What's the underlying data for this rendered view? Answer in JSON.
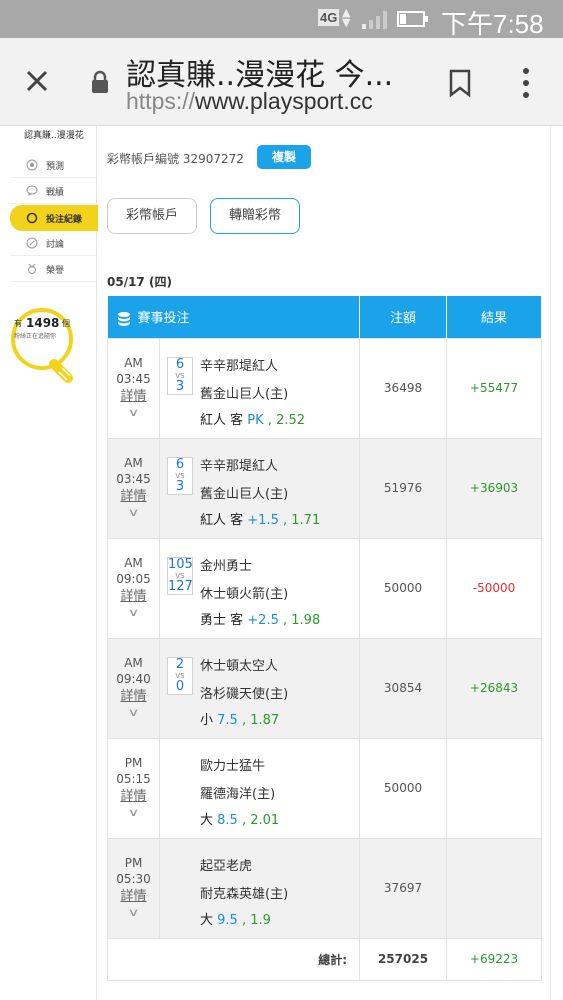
{
  "status_bar": {
    "network": "4G",
    "time": "下午7:58"
  },
  "browser": {
    "page_title": "認真賺..漫漫花 今...",
    "url_protocol": "https://",
    "url_host": "www.playsport.cc"
  },
  "sidebar": {
    "username": "認真賺..漫漫花",
    "items": [
      {
        "label": "預測",
        "icon": "target-icon"
      },
      {
        "label": "戰績",
        "icon": "chat-icon"
      },
      {
        "label": "投注紀錄",
        "icon": "circle-icon",
        "active": true
      },
      {
        "label": "討論",
        "icon": "edit-icon"
      },
      {
        "label": "榮譽",
        "icon": "medal-icon"
      }
    ],
    "fans": {
      "prefix": "有",
      "count": "1498",
      "suffix": "個",
      "subtext": "粉絲正在追隨你"
    }
  },
  "account": {
    "label": "彩幣帳戶編號 32907272",
    "copy_button": "複製"
  },
  "tabs": [
    "彩幣帳戶",
    "轉贈彩幣"
  ],
  "date": "05/17 (四)",
  "table": {
    "headers": {
      "event": "賽事投注",
      "amount": "注額",
      "result": "結果"
    },
    "rows": [
      {
        "ampm": "AM",
        "time": "03:45",
        "detail": "詳情",
        "score_top": "6",
        "score_vs": "VS",
        "score_bottom": "3",
        "team1": "辛辛那堤紅人",
        "team2": "舊金山巨人(主)",
        "pick_team": "紅人 客",
        "pick_line": "PK",
        "pick_sep": " , ",
        "pick_odds": "2.52",
        "amount": "36498",
        "result": "+55477",
        "win": true
      },
      {
        "ampm": "AM",
        "time": "03:45",
        "detail": "詳情",
        "score_top": "6",
        "score_vs": "VS",
        "score_bottom": "3",
        "team1": "辛辛那堤紅人",
        "team2": "舊金山巨人(主)",
        "pick_team": "紅人 客",
        "pick_line": "+1.5",
        "pick_sep": " , ",
        "pick_odds": "1.71",
        "amount": "51976",
        "result": "+36903",
        "win": true
      },
      {
        "ampm": "AM",
        "time": "09:05",
        "detail": "詳情",
        "score_top": "105",
        "score_vs": "VS",
        "score_bottom": "127",
        "team1": "金州勇士",
        "team2": "休士頓火箭(主)",
        "pick_team": "勇士 客",
        "pick_line": "+2.5",
        "pick_sep": " , ",
        "pick_odds": "1.98",
        "amount": "50000",
        "result": "-50000",
        "win": false
      },
      {
        "ampm": "AM",
        "time": "09:40",
        "detail": "詳情",
        "score_top": "2",
        "score_vs": "VS",
        "score_bottom": "0",
        "team1": "休士頓太空人",
        "team2": "洛杉磯天使(主)",
        "pick_team": "小",
        "pick_line": "7.5",
        "pick_sep": " , ",
        "pick_odds": "1.87",
        "amount": "30854",
        "result": "+26843",
        "win": true
      },
      {
        "ampm": "PM",
        "time": "05:15",
        "detail": "詳情",
        "score_top": "",
        "score_vs": "",
        "score_bottom": "",
        "team1": "歐力士猛牛",
        "team2": "羅德海洋(主)",
        "pick_team": "大",
        "pick_line": "8.5",
        "pick_sep": " , ",
        "pick_odds": "2.01",
        "amount": "50000",
        "result": "",
        "win": true
      },
      {
        "ampm": "PM",
        "time": "05:30",
        "detail": "詳情",
        "score_top": "",
        "score_vs": "",
        "score_bottom": "",
        "team1": "起亞老虎",
        "team2": "耐克森英雄(主)",
        "pick_team": "大",
        "pick_line": "9.5",
        "pick_sep": " , ",
        "pick_odds": "1.9",
        "amount": "37697",
        "result": "",
        "win": true
      }
    ],
    "total": {
      "label": "總計:",
      "amount": "257025",
      "result": "+69223"
    }
  },
  "colors": {
    "accent": "#1aa3e8",
    "active_menu": "#f3d21c",
    "win": "#2a9a2a",
    "loss": "#e03030"
  }
}
